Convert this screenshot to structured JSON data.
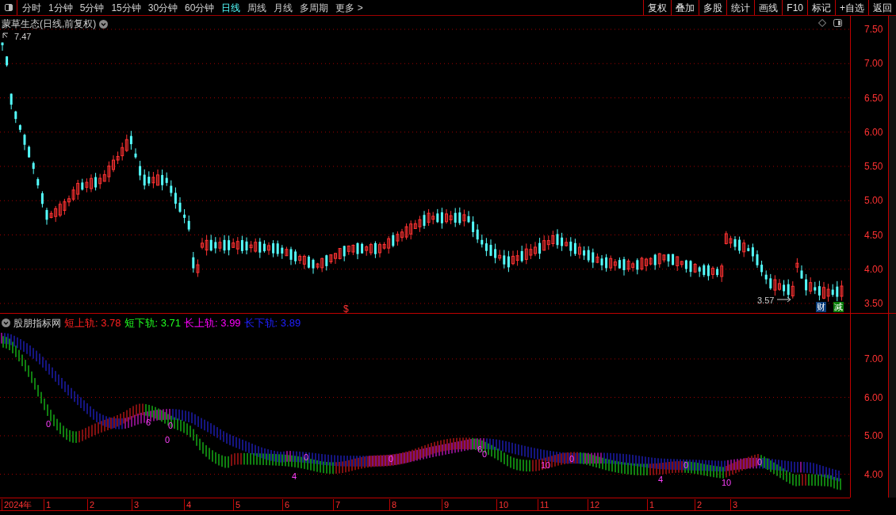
{
  "toolbar": {
    "periods": [
      {
        "label": "分时",
        "selected": false
      },
      {
        "label": "1分钟",
        "selected": false
      },
      {
        "label": "5分钟",
        "selected": false
      },
      {
        "label": "15分钟",
        "selected": false
      },
      {
        "label": "30分钟",
        "selected": false
      },
      {
        "label": "60分钟",
        "selected": false
      },
      {
        "label": "日线",
        "selected": true
      },
      {
        "label": "周线",
        "selected": false
      },
      {
        "label": "月线",
        "selected": false
      },
      {
        "label": "多周期",
        "selected": false
      }
    ],
    "more": "更多 >",
    "actions": [
      "复权",
      "叠加",
      "多股",
      "统计",
      "画线",
      "F10",
      "标记",
      "+自选",
      "返回"
    ]
  },
  "main_chart": {
    "title": "蒙草生态(日线,前复权)",
    "high_label": "7.47",
    "low_label": "3.57",
    "marker": "$",
    "badges": [
      {
        "label": "财",
        "color": "#0b3d7a"
      },
      {
        "label": "减",
        "color": "#0a7d0a"
      }
    ],
    "yaxis": [
      "7.50",
      "7.00",
      "6.50",
      "6.00",
      "5.50",
      "5.00",
      "4.50",
      "4.00",
      "3.50"
    ]
  },
  "indicator": {
    "name": "股朋指标网",
    "lines": [
      {
        "label": "短上轨: 3.78",
        "color": "#ff2020"
      },
      {
        "label": "短下轨: 3.71",
        "color": "#20ff20"
      },
      {
        "label": "长上轨: 3.99",
        "color": "#ff00ff"
      },
      {
        "label": "长下轨: 3.89",
        "color": "#2020ff"
      }
    ],
    "signals": [
      "0",
      "6",
      "0",
      "0",
      "4",
      "0",
      "0",
      "6",
      "0",
      "10",
      "0",
      "4",
      "0",
      "10",
      "0"
    ],
    "yaxis": [
      "7.00",
      "6.00",
      "5.00",
      "4.00"
    ]
  },
  "date_axis": [
    "2024年",
    "1",
    "2",
    "3",
    "4",
    "5",
    "6",
    "7",
    "8",
    "9",
    "10",
    "11",
    "12",
    "1",
    "2",
    "3"
  ]
}
